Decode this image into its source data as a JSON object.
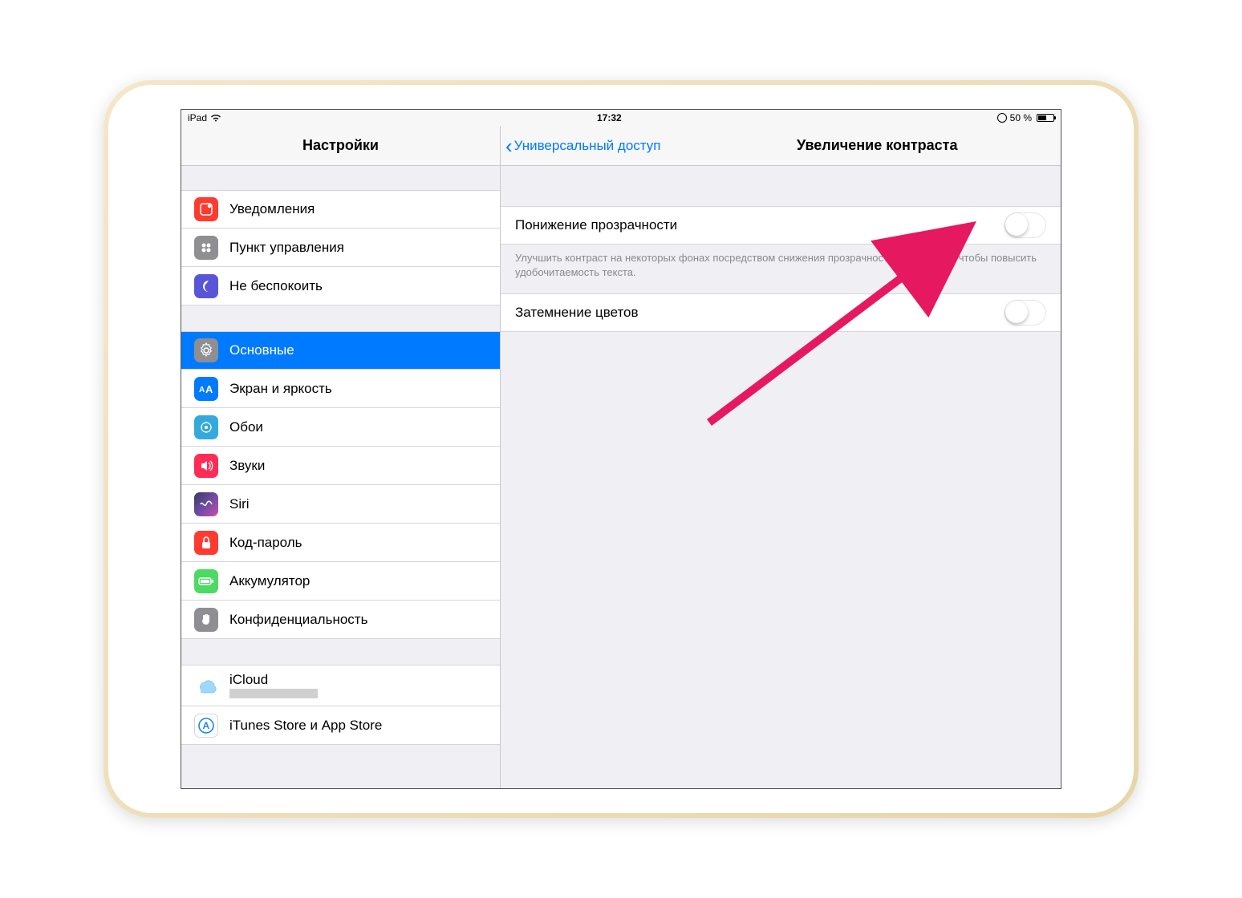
{
  "status": {
    "device": "iPad",
    "time": "17:32",
    "battery_pct": "50 %"
  },
  "sidebar": {
    "title": "Настройки",
    "group1": [
      {
        "label": "Уведомления"
      },
      {
        "label": "Пункт управления"
      },
      {
        "label": "Не беспокоить"
      }
    ],
    "group2": [
      {
        "label": "Основные"
      },
      {
        "label": "Экран и яркость"
      },
      {
        "label": "Обои"
      },
      {
        "label": "Звуки"
      },
      {
        "label": "Siri"
      },
      {
        "label": "Код-пароль"
      },
      {
        "label": "Аккумулятор"
      },
      {
        "label": "Конфиденциальность"
      }
    ],
    "group3": [
      {
        "label": "iCloud"
      },
      {
        "label": "iTunes Store и App Store"
      }
    ]
  },
  "detail": {
    "back_label": "Универсальный доступ",
    "title": "Увеличение контраста",
    "row1_label": "Понижение прозрачности",
    "row1_note": "Улучшить контраст на некоторых фонах посредством снижения прозрачности и размытия, чтобы повысить удобочитаемость текста.",
    "row2_label": "Затемнение цветов"
  },
  "colors": {
    "accent": "#007aff",
    "arrow": "#e91e63"
  }
}
